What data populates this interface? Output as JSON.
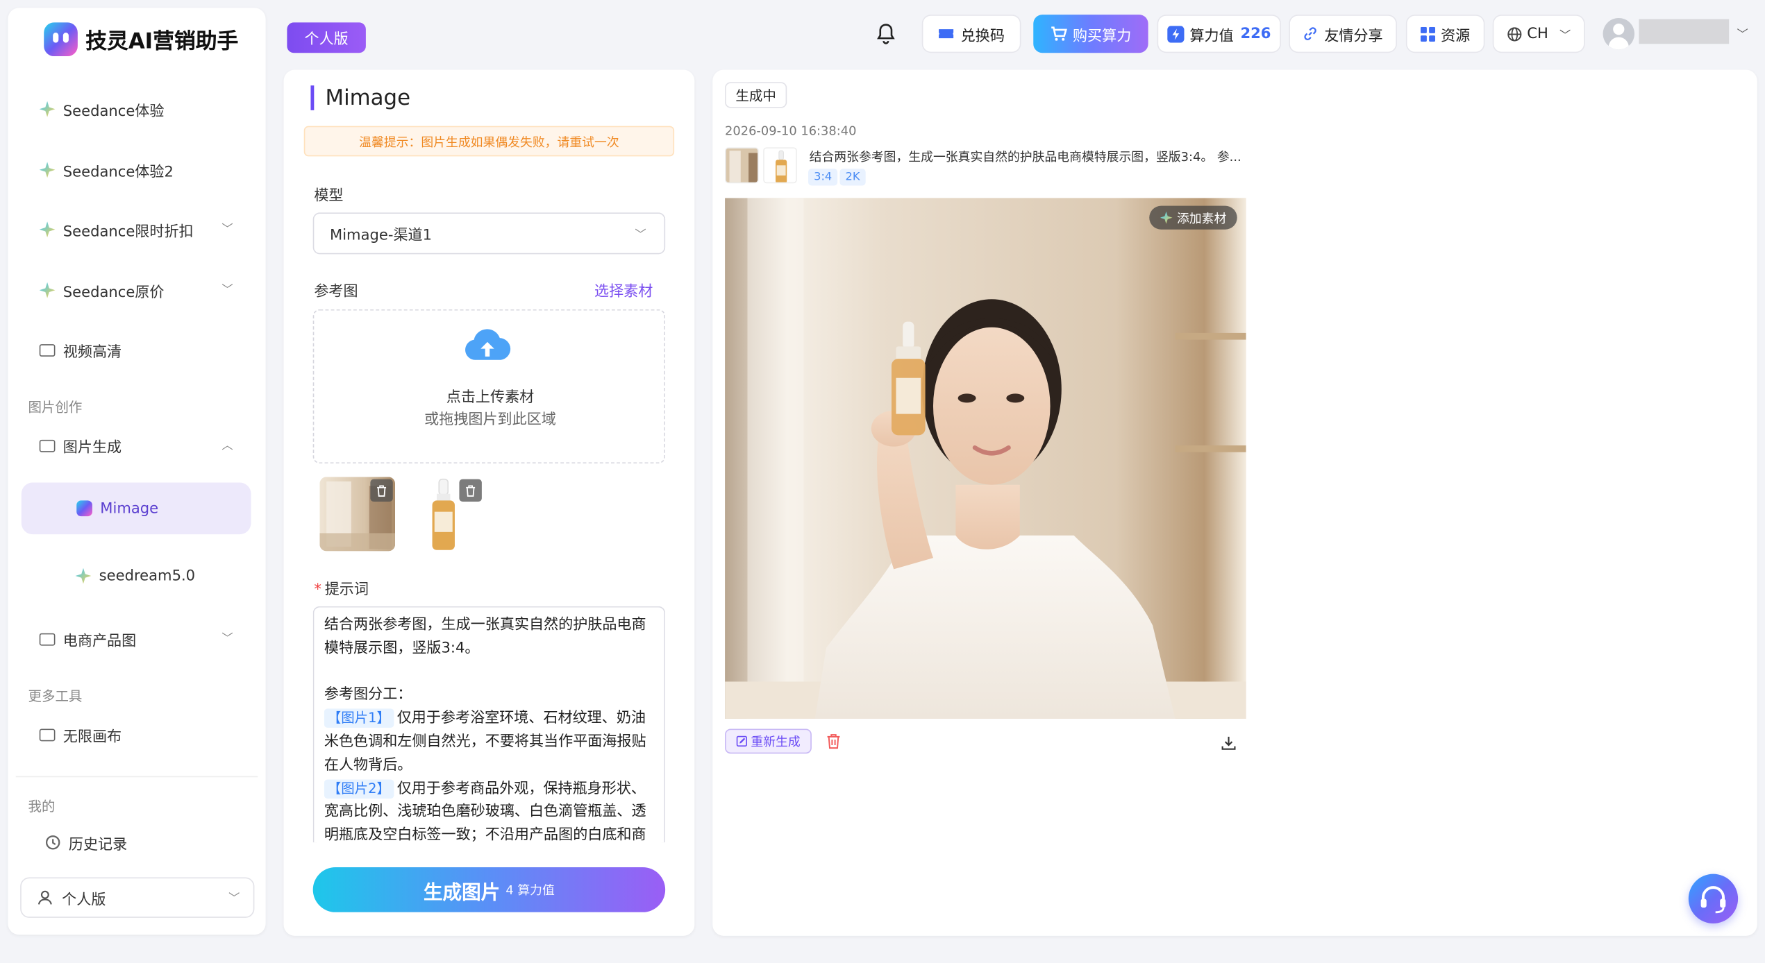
{
  "app": {
    "title": "技灵AI营销助手"
  },
  "sidebar": {
    "items": [
      {
        "label": "Seedance体验"
      },
      {
        "label": "Seedance体验2"
      },
      {
        "label": "Seedance限时折扣"
      },
      {
        "label": "Seedance原价"
      },
      {
        "label": "视频高清"
      },
      {
        "label": "图片生成"
      },
      {
        "label": "Mimage"
      },
      {
        "label": "seedream5.0"
      },
      {
        "label": "电商产品图"
      },
      {
        "label": "无限画布"
      },
      {
        "label": "历史记录"
      }
    ],
    "sections": {
      "image_creation": "图片创作",
      "more_tools": "更多工具",
      "mine": "我的"
    },
    "plan": "个人版"
  },
  "topbar": {
    "edition_badge": "个人版",
    "redeem": "兑换码",
    "buy": "购买算力",
    "points_label": "算力值",
    "points_value": "226",
    "share": "友情分享",
    "resources": "资源",
    "language": "CH"
  },
  "form": {
    "title": "Mimage",
    "notice": "温馨提示：图片生成如果偶发失败，请重试一次",
    "model_label": "模型",
    "model_value": "Mimage-渠道1",
    "ref_label": "参考图",
    "choose_material": "选择素材",
    "upload_title": "点击上传素材",
    "upload_hint": "或拖拽图片到此区域",
    "prompt_label": "提示词",
    "prompt_lines": {
      "l1": "结合两张参考图，生成一张真实自然的护肤品电商模特展示图，竖版3:4。",
      "l2": "参考图分工：",
      "tag1": "【图片1】",
      "l3": "仅用于参考浴室环境、石材纹理、奶油米色色调和左侧自然光，不要将其当作平面海报贴在人物背后。",
      "tag2": "【图片2】",
      "l4": "仅用于参考商品外观，保持瓶身形状、宽高比例、浅琥珀色磨砂玻璃、白色滴管瓶盖、透明瓶底及空白标签一致；不沿用产品图的白底和商"
    },
    "generate_label": "生成图片",
    "generate_cost": "4 算力值"
  },
  "result": {
    "status": "生成中",
    "timestamp": "2026-09-10 16:38:40",
    "prompt_preview": "结合两张参考图，生成一张真实自然的护肤品电商模特展示图，竖版3:4。 参...",
    "chips": [
      "3:4",
      "2K"
    ],
    "add_material": "添加素材",
    "regenerate": "重新生成"
  },
  "colors": {
    "accent": "#6b4cf5",
    "notice": "#f08a24",
    "tag": "#2f7df6"
  }
}
